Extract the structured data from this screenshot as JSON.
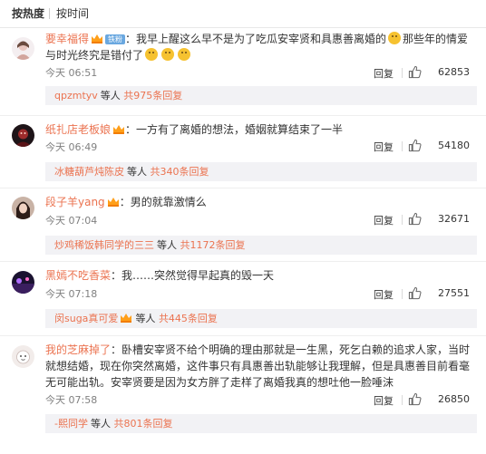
{
  "sort_tabs": [
    "按热度",
    "按时间"
  ],
  "badges": {
    "fan": "铁粉"
  },
  "actions": {
    "reply": "回复"
  },
  "colors": {
    "username": "#eb7350",
    "link": "#eb7350",
    "time": "#808080",
    "reply_bg": "#f2f2f5"
  },
  "comments": [
    {
      "user": "要幸福得",
      "text": "：我早上醒这么早不是为了吃瓜安宰贤和具惠善离婚的",
      "text2": "那些年的情爱与时光终究是错付了",
      "time": "今天 06:51",
      "likes": "62853",
      "sub": {
        "names": "qpzmtyv",
        "middle": "等人",
        "count": "共975条回复"
      }
    },
    {
      "user": "纸扎店老板娘",
      "text": "：一方有了离婚的想法，婚姻就算结束了一半",
      "time": "今天 06:49",
      "likes": "54180",
      "sub": {
        "names": "冰糖葫芦炖陈皮",
        "middle": "等人",
        "count": "共340条回复"
      }
    },
    {
      "user": "段子羊yang",
      "text": "：男的就靠激情么",
      "time": "今天 07:04",
      "likes": "32671",
      "sub": {
        "names": "炒鸡稀饭韩同学的三三",
        "middle": "等人",
        "count": "共1172条回复"
      }
    },
    {
      "user": "黑嫣不吃香菜",
      "text": "：我……突然觉得早起真的毁一天",
      "time": "今天 07:18",
      "likes": "27551",
      "sub": {
        "names": "闵suga真可爱",
        "middle": "等人",
        "count": "共445条回复"
      }
    },
    {
      "user": "我的芝麻掉了",
      "text": "：卧槽安宰贤不给个明确的理由那就是一生黑，死乞白赖的追求人家，当时就想结婚，现在你突然离婚，这件事只有具惠善出轨能够让我理解，但是具惠善目前看毫无可能出轨。安宰贤要是因为女方胖了走样了离婚我真的想吐他一脸唾沫",
      "time": "今天 07:58",
      "likes": "26850",
      "sub": {
        "names": "-熙同学",
        "middle": "等人",
        "count": "共801条回复"
      }
    }
  ]
}
